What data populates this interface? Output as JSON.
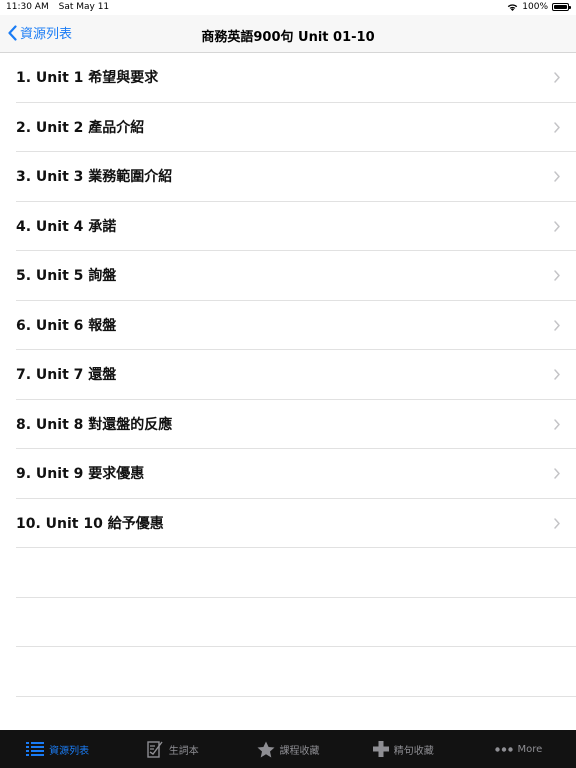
{
  "status": {
    "time": "11:30 AM",
    "date": "Sat May 11",
    "battery": "100%",
    "battery_level": 1.0
  },
  "nav": {
    "back_label": "資源列表",
    "title": "商務英語900句 Unit 01-10"
  },
  "units": [
    {
      "label": "1. Unit 1 希望與要求"
    },
    {
      "label": "2. Unit 2 產品介紹"
    },
    {
      "label": "3. Unit 3 業務範圍介紹"
    },
    {
      "label": "4. Unit 4 承諾"
    },
    {
      "label": "5. Unit 5 詢盤"
    },
    {
      "label": "6. Unit 6 報盤"
    },
    {
      "label": "7. Unit 7 還盤"
    },
    {
      "label": "8. Unit 8 對還盤的反應"
    },
    {
      "label": "9. Unit 9 要求優惠"
    },
    {
      "label": "10. Unit 10 給予優惠"
    }
  ],
  "tabs": [
    {
      "label": "資源列表",
      "icon": "list-icon",
      "active": true
    },
    {
      "label": "生詞本",
      "icon": "notebook-icon",
      "active": false
    },
    {
      "label": "課程收藏",
      "icon": "star-icon",
      "active": false
    },
    {
      "label": "精句收藏",
      "icon": "plus-icon",
      "active": false
    },
    {
      "label": "More",
      "icon": "more-icon",
      "active": false
    }
  ],
  "colors": {
    "accent": "#1a7cf5",
    "tab_bar_bg": "#121212",
    "inactive_tab": "#8e8e93"
  }
}
